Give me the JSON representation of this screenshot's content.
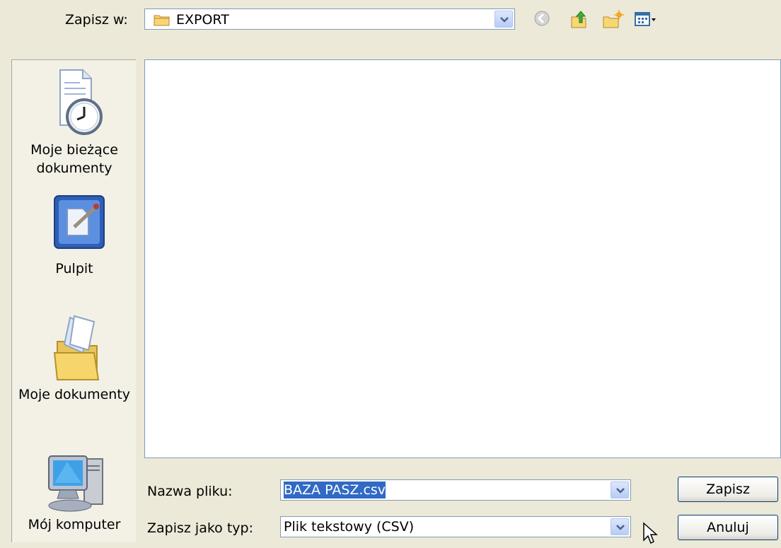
{
  "save_in": {
    "label": "Zapisz w:",
    "location": "EXPORT"
  },
  "toolbar": {
    "icons": [
      "back-icon",
      "up-folder-icon",
      "new-folder-icon",
      "view-menu-icon"
    ]
  },
  "places": [
    {
      "label_line1": "Moje bieżące",
      "label_line2": "dokumenty",
      "icon": "recent-documents-icon"
    },
    {
      "label_line1": "Pulpit",
      "icon": "desktop-icon"
    },
    {
      "label_line1": "Moje dokumenty",
      "icon": "my-documents-icon"
    },
    {
      "label_line1": "Mój komputer",
      "icon": "my-computer-icon"
    }
  ],
  "filename": {
    "label": "Nazwa pliku:",
    "value": "BAZA PASZ.csv"
  },
  "filetype": {
    "label": "Zapisz jako typ:",
    "value": "Plik tekstowy (CSV)"
  },
  "buttons": {
    "save": "Zapisz",
    "cancel": "Anuluj"
  },
  "colors": {
    "dialog_bg": "#ECE9D8",
    "selection": "#316AC5",
    "field_border": "#7F9DB9"
  }
}
